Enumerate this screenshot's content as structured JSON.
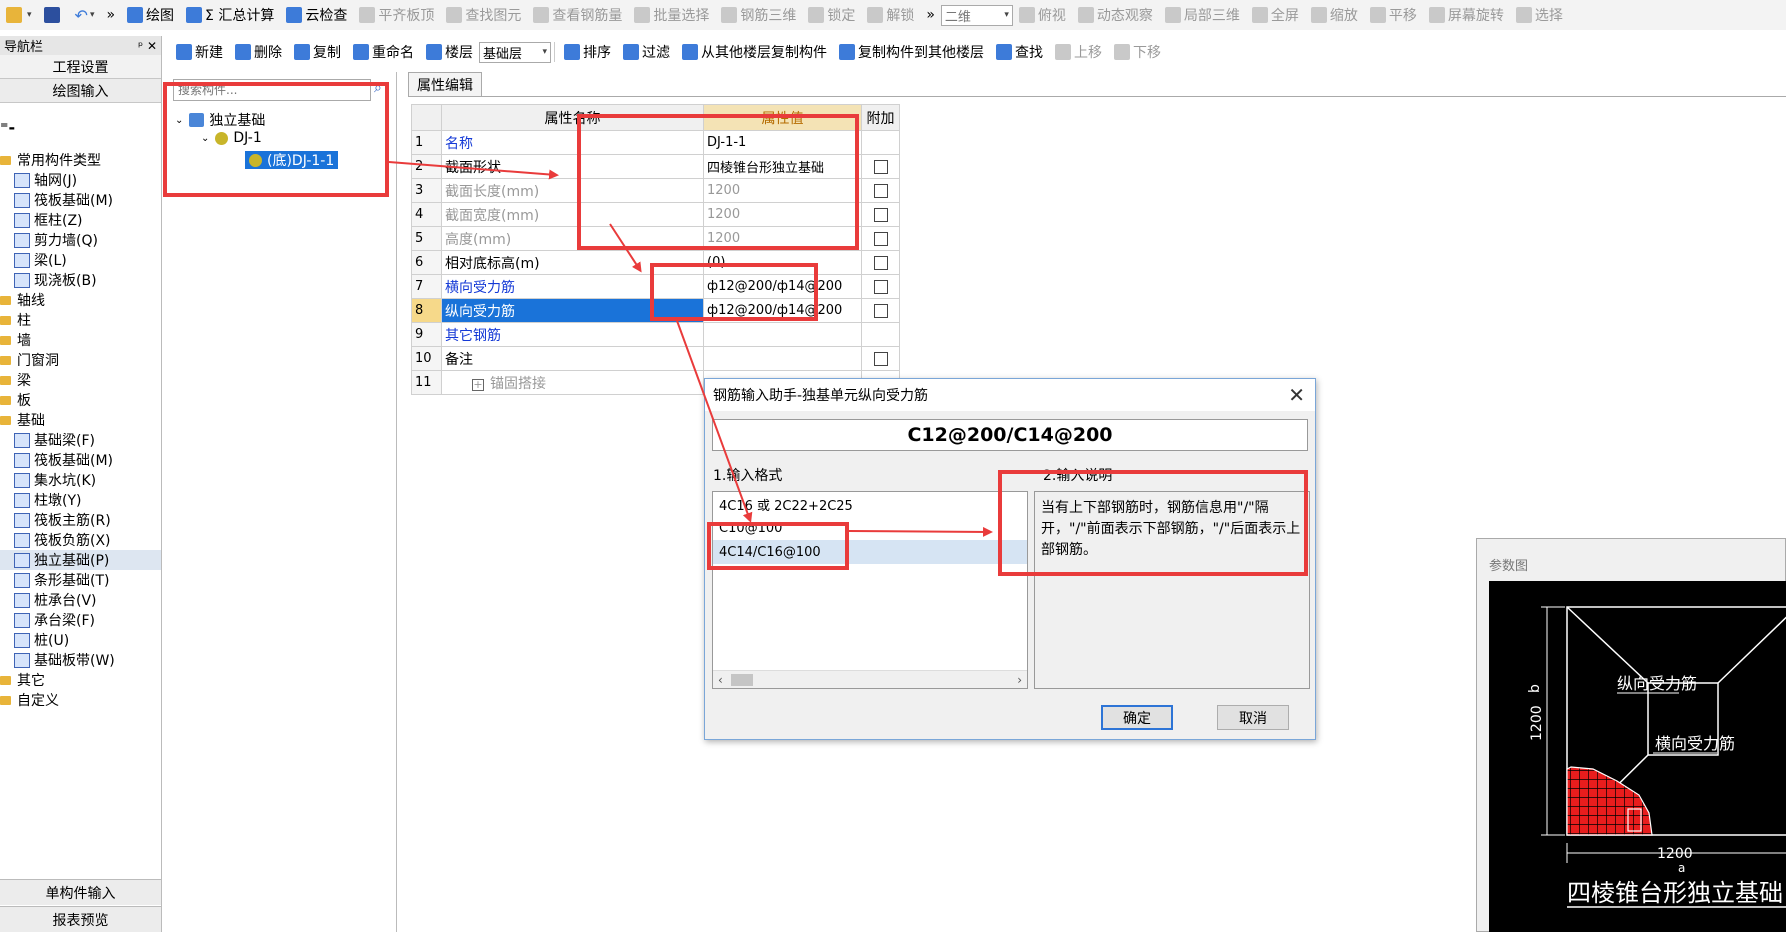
{
  "toolbar1": {
    "items": [
      {
        "label": "绘图",
        "state": "en"
      },
      {
        "label": "Σ 汇总计算",
        "state": "en"
      },
      {
        "label": "云检查",
        "state": "en"
      },
      {
        "label": "平齐板顶",
        "state": "dis"
      },
      {
        "label": "查找图元",
        "state": "dis"
      },
      {
        "label": "查看钢筋量",
        "state": "dis"
      },
      {
        "label": "批量选择",
        "state": "dis"
      },
      {
        "label": "钢筋三维",
        "state": "dis"
      },
      {
        "label": "锁定",
        "state": "dis"
      },
      {
        "label": "解锁",
        "state": "dis"
      }
    ],
    "view_combo": "二维",
    "view_items": [
      "俯视",
      "动态观察",
      "局部三维",
      "全屏",
      "缩放",
      "平移",
      "屏幕旋转",
      "选择"
    ]
  },
  "toolbar2": {
    "items": [
      {
        "label": "新建"
      },
      {
        "label": "删除"
      },
      {
        "label": "复制"
      },
      {
        "label": "重命名"
      },
      {
        "label": "楼层"
      }
    ],
    "floor_combo": "基础层",
    "items2": [
      {
        "label": "排序"
      },
      {
        "label": "过滤"
      },
      {
        "label": "从其他楼层复制构件"
      },
      {
        "label": "复制构件到其他楼层"
      },
      {
        "label": "查找"
      }
    ],
    "disabled": [
      "上移",
      "下移"
    ]
  },
  "nav": {
    "title": "导航栏",
    "pin": "ᵖ ✕",
    "top_buttons": [
      "工程设置",
      "绘图输入"
    ],
    "tree": [
      {
        "label": "常用构件类型",
        "level": 0,
        "type": "folder"
      },
      {
        "label": "轴网(J)",
        "level": 1,
        "type": "comp"
      },
      {
        "label": "筏板基础(M)",
        "level": 1,
        "type": "comp"
      },
      {
        "label": "框柱(Z)",
        "level": 1,
        "type": "comp"
      },
      {
        "label": "剪力墙(Q)",
        "level": 1,
        "type": "comp"
      },
      {
        "label": "梁(L)",
        "level": 1,
        "type": "comp"
      },
      {
        "label": "现浇板(B)",
        "level": 1,
        "type": "comp"
      },
      {
        "label": "轴线",
        "level": 0,
        "type": "folder"
      },
      {
        "label": "柱",
        "level": 0,
        "type": "folder"
      },
      {
        "label": "墙",
        "level": 0,
        "type": "folder"
      },
      {
        "label": "门窗洞",
        "level": 0,
        "type": "folder"
      },
      {
        "label": "梁",
        "level": 0,
        "type": "folder"
      },
      {
        "label": "板",
        "level": 0,
        "type": "folder"
      },
      {
        "label": "基础",
        "level": 0,
        "type": "folder"
      },
      {
        "label": "基础梁(F)",
        "level": 1,
        "type": "comp"
      },
      {
        "label": "筏板基础(M)",
        "level": 1,
        "type": "comp"
      },
      {
        "label": "集水坑(K)",
        "level": 1,
        "type": "comp"
      },
      {
        "label": "柱墩(Y)",
        "level": 1,
        "type": "comp"
      },
      {
        "label": "筏板主筋(R)",
        "level": 1,
        "type": "comp"
      },
      {
        "label": "筏板负筋(X)",
        "level": 1,
        "type": "comp"
      },
      {
        "label": "独立基础(P)",
        "level": 1,
        "type": "comp",
        "selected": true
      },
      {
        "label": "条形基础(T)",
        "level": 1,
        "type": "comp"
      },
      {
        "label": "桩承台(V)",
        "level": 1,
        "type": "comp"
      },
      {
        "label": "承台梁(F)",
        "level": 1,
        "type": "comp"
      },
      {
        "label": "桩(U)",
        "level": 1,
        "type": "comp"
      },
      {
        "label": "基础板带(W)",
        "level": 1,
        "type": "comp"
      },
      {
        "label": "其它",
        "level": 0,
        "type": "folder"
      },
      {
        "label": "自定义",
        "level": 0,
        "type": "folder"
      }
    ],
    "bottom_buttons": [
      "单构件输入",
      "报表预览"
    ]
  },
  "comp_tree": {
    "search_placeholder": "搜索构件...",
    "root": "独立基础",
    "child": "DJ-1",
    "leaf": "(底)DJ-1-1"
  },
  "prop": {
    "tab": "属性编辑",
    "headers": [
      "属性名称",
      "属性值",
      "附加"
    ],
    "rows": [
      {
        "n": "1",
        "name": "名称",
        "value": "DJ-1-1",
        "nc": "blue",
        "vc": "",
        "cb": false
      },
      {
        "n": "2",
        "name": "截面形状",
        "value": "四棱锥台形独立基础",
        "nc": "",
        "vc": "",
        "cb": true
      },
      {
        "n": "3",
        "name": "截面长度(mm)",
        "value": "1200",
        "nc": "gray",
        "vc": "gray",
        "cb": true
      },
      {
        "n": "4",
        "name": "截面宽度(mm)",
        "value": "1200",
        "nc": "gray",
        "vc": "gray",
        "cb": true
      },
      {
        "n": "5",
        "name": "高度(mm)",
        "value": "1200",
        "nc": "gray",
        "vc": "gray",
        "cb": true
      },
      {
        "n": "6",
        "name": "相对底标高(m)",
        "value": "(0)",
        "nc": "",
        "vc": "",
        "cb": true
      },
      {
        "n": "7",
        "name": "横向受力筋",
        "value": "ф12@200/ф14@200",
        "nc": "blue",
        "vc": "",
        "cb": true
      },
      {
        "n": "8",
        "name": "纵向受力筋",
        "value": "ф12@200/ф14@200",
        "nc": "",
        "vc": "",
        "cb": true,
        "selected": true
      },
      {
        "n": "9",
        "name": "其它钢筋",
        "value": "",
        "nc": "blue",
        "vc": "",
        "cb": false
      },
      {
        "n": "10",
        "name": "备注",
        "value": "",
        "nc": "",
        "vc": "",
        "cb": true
      },
      {
        "n": "11",
        "name": "锚固搭接",
        "value": "",
        "nc": "gray",
        "vc": "",
        "cb": false,
        "expand": true
      }
    ]
  },
  "dialog": {
    "title": "钢筋输入助手-独基单元纵向受力筋",
    "close": "✕",
    "value": "C12@200/C14@200",
    "section1": "1.输入格式",
    "section2": "2.输入说明",
    "formats": [
      "4C16 或 2C22+2C25",
      "C10@100",
      "4C14/C16@100"
    ],
    "selected_index": 2,
    "description": "当有上下部钢筋时，钢筋信息用\"/\"隔开，\"/\"前面表示下部钢筋，\"/\"后面表示上部钢筋。",
    "ok": "确定",
    "cancel": "取消",
    "scroll_left": "‹",
    "scroll_right": "›"
  },
  "param_panel": {
    "title": "参数图",
    "label_long": "纵向受力筋",
    "label_trans": "横向受力筋",
    "dim_b": "1200",
    "dim_b_label": "b",
    "dim_a": "1200",
    "dim_a_label": "a",
    "caption": "四棱锥台形独立基础"
  },
  "colors": {
    "highlight_box": "#e93b3b",
    "selection_blue": "#1a73d9",
    "link_blue": "#1439d6"
  }
}
